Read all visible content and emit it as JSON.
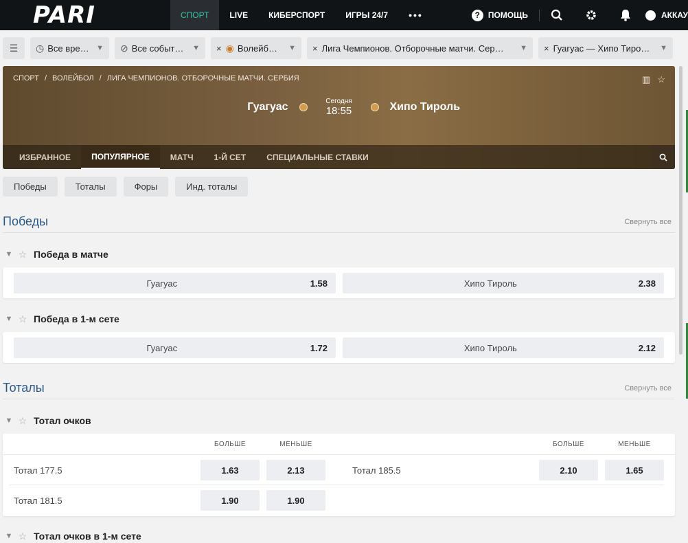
{
  "brand": "PARI",
  "nav": [
    "СПОРТ",
    "LIVE",
    "КИБЕРСПОРТ",
    "ИГРЫ 24/7",
    "•••"
  ],
  "help_label": "ПОМОЩЬ",
  "account_label": "АККАУ",
  "filters": {
    "time": "Все вре…",
    "events": "Все событ…",
    "sport": "Волейб…",
    "league": "Лига Чемпионов. Отборочные матчи. Сер…",
    "match": "Гуагуас — Хипо Тиро…"
  },
  "breadcrumbs": [
    "СПОРТ",
    "/",
    "ВОЛЕЙБОЛ",
    "/",
    "ЛИГА ЧЕМПИОНОВ. ОТБОРОЧНЫЕ МАТЧИ. СЕРБИЯ"
  ],
  "match": {
    "home": "Гуагуас",
    "away": "Хипо Тироль",
    "day": "Сегодня",
    "time": "18:55"
  },
  "tabs": [
    "ИЗБРАННОЕ",
    "ПОПУЛЯРНОЕ",
    "МАТЧ",
    "1-Й СЕТ",
    "СПЕЦИАЛЬНЫЕ СТАВКИ"
  ],
  "active_tab": "ПОПУЛЯРНОЕ",
  "pills": [
    "Победы",
    "Тоталы",
    "Форы",
    "Инд. тоталы"
  ],
  "collapse_all": "Свернуть все",
  "sections": {
    "wins": "Победы",
    "totals": "Тоталы"
  },
  "markets": {
    "match_win": {
      "title": "Победа в матче",
      "home": "Гуагуас",
      "home_odd": "1.58",
      "away": "Хипо Тироль",
      "away_odd": "2.38"
    },
    "set1_win": {
      "title": "Победа в 1-м сете",
      "home": "Гуагуас",
      "home_odd": "1.72",
      "away": "Хипо Тироль",
      "away_odd": "2.12"
    },
    "total_points": {
      "title": "Тотал очков",
      "over": "БОЛЬШЕ",
      "under": "МЕНЬШЕ",
      "rows": [
        {
          "label": "Тотал 177.5",
          "over": "1.63",
          "under": "2.13"
        },
        {
          "label": "Тотал 185.5",
          "over": "2.10",
          "under": "1.65"
        },
        {
          "label": "Тотал 181.5",
          "over": "1.90",
          "under": "1.90"
        }
      ]
    },
    "set1_total": {
      "title": "Тотал очков в 1-м сете"
    }
  },
  "colors": {
    "accent": "#34c0a2",
    "topbar": "#111417",
    "section_title": "#2d5a84"
  }
}
